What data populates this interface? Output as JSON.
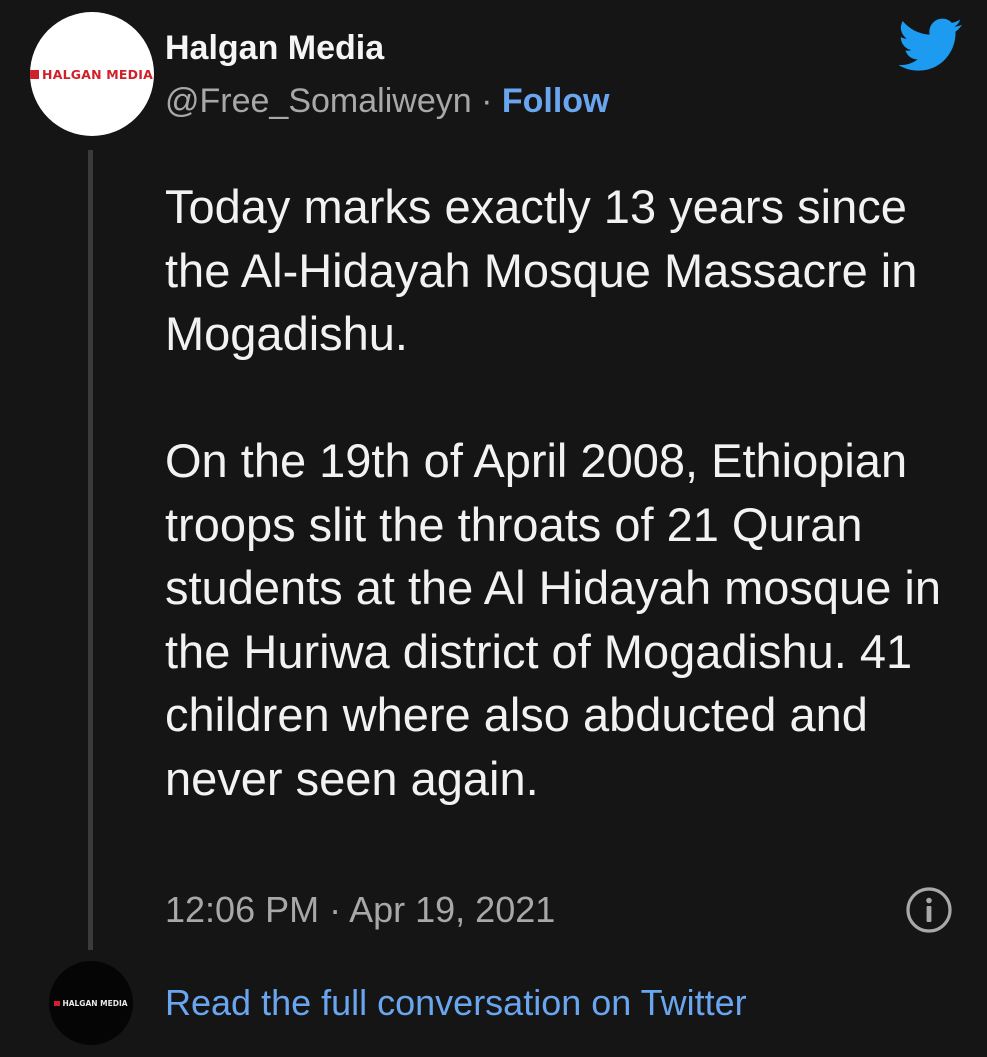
{
  "author": {
    "display_name": "Halgan Media",
    "handle": "@Free_Somaliweyn",
    "separator": " · ",
    "follow_label": "Follow",
    "avatar_logo_text": "HALGAN MEDIA",
    "avatar_icon": "halgan-media-logo"
  },
  "tweet": {
    "paragraphs": [
      "Today marks exactly 13 years since the Al-Hidayah Mosque Massacre in Mogadishu.",
      "On the 19th of April 2008, Ethiopian troops slit the throats of 21 Quran students at the Al Hidayah mosque in the Huriwa district of Mogadishu. 41 children where also abducted and never seen again."
    ],
    "timestamp": "12:06 PM · Apr 19, 2021"
  },
  "footer": {
    "read_full_label": "Read the full conversation on Twitter",
    "small_avatar_logo_text": "HALGAN MEDIA"
  },
  "icons": {
    "brand": "twitter-bird-icon",
    "info": "info-icon"
  },
  "colors": {
    "background": "#151515",
    "text": "#f2f2f2",
    "muted": "#a8a8a8",
    "link": "#6aa6f0",
    "twitter_blue": "#1d9bf0",
    "logo_red": "#d0202a"
  }
}
